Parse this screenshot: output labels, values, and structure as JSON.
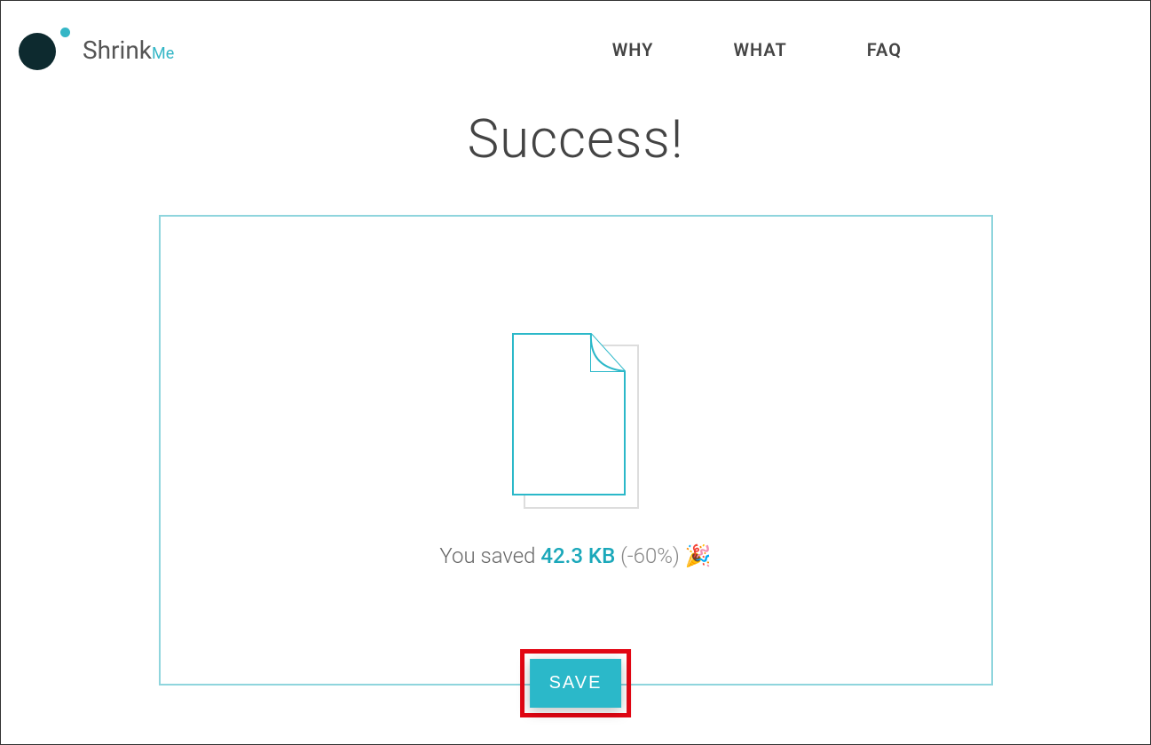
{
  "brand": {
    "name_main": "Shrink",
    "name_accent": "Me"
  },
  "nav": {
    "items": [
      {
        "label": "WHY"
      },
      {
        "label": "WHAT"
      },
      {
        "label": "FAQ"
      }
    ]
  },
  "main": {
    "title": "Success!",
    "saved_prefix": "You saved ",
    "saved_amount": "42.3 KB",
    "saved_pct": " (-60%) ",
    "celebrate_emoji": "🎉"
  },
  "actions": {
    "save_label": "SAVE"
  }
}
